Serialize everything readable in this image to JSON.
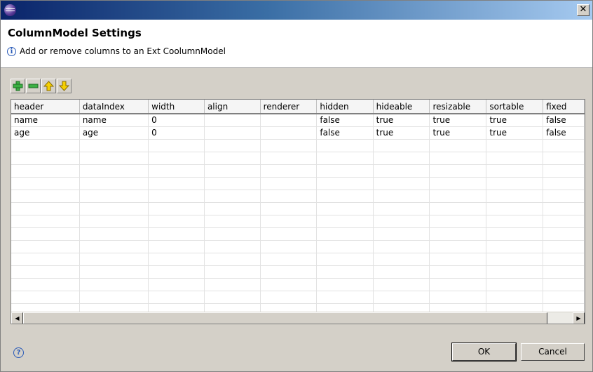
{
  "window": {
    "close_glyph": "✕"
  },
  "dialog": {
    "title": "ColumnModel Settings",
    "message": "Add or remove columns to an Ext CoolumnModel",
    "info_glyph": "i"
  },
  "toolbar": {
    "icons": [
      "add-icon",
      "remove-icon",
      "move-up-icon",
      "move-down-icon"
    ]
  },
  "table": {
    "columns": [
      "header",
      "dataIndex",
      "width",
      "align",
      "renderer",
      "hidden",
      "hideable",
      "resizable",
      "sortable",
      "fixed"
    ],
    "rows": [
      [
        "name",
        "name",
        "0",
        "",
        "",
        "false",
        "true",
        "true",
        "true",
        "false"
      ],
      [
        "age",
        "age",
        "0",
        "",
        "",
        "false",
        "true",
        "true",
        "true",
        "false"
      ]
    ],
    "empty_rows": 14
  },
  "scrollbar": {
    "left_glyph": "◀",
    "right_glyph": "▶"
  },
  "footer": {
    "help_glyph": "?",
    "ok_label": "OK",
    "cancel_label": "Cancel"
  },
  "colors": {
    "accent": "#2a5bb8",
    "add_green": "#3cb043",
    "arrow_yellow": "#f5d000"
  }
}
